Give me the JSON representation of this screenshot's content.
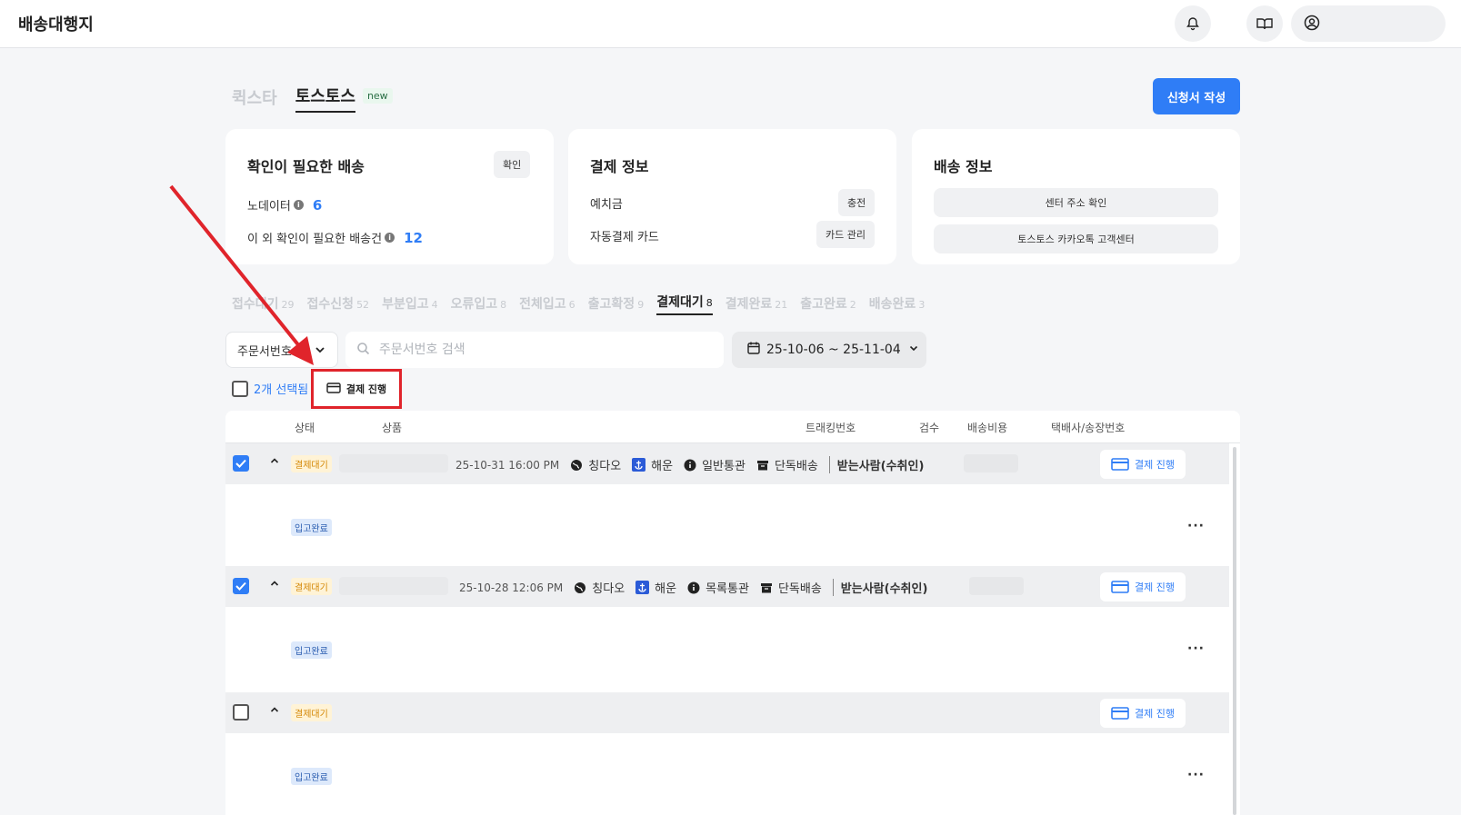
{
  "app": {
    "title": "배송대행지"
  },
  "header": {
    "icons": [
      "bell-icon",
      "book-icon",
      "user-circle-icon"
    ]
  },
  "main_tabs": [
    {
      "label": "퀵스타",
      "active": false
    },
    {
      "label": "토스토스",
      "active": true,
      "badge": "new"
    }
  ],
  "apply_button": "신청서 작성",
  "cards": {
    "check": {
      "title": "확인이 필요한 배송",
      "button": "확인",
      "rows": [
        {
          "label": "노데이터",
          "value": "6"
        },
        {
          "label": "이 외 확인이 필요한 배송건",
          "value": "12"
        }
      ]
    },
    "payment": {
      "title": "결제 정보",
      "rows": [
        {
          "label": "예치금",
          "button": "충전"
        },
        {
          "label": "자동결제 카드",
          "button": "카드 관리"
        }
      ]
    },
    "shipping": {
      "title": "배송 정보",
      "buttons": [
        "센터 주소 확인",
        "토스토스 카카오톡 고객센터"
      ]
    }
  },
  "status_tabs": [
    {
      "label": "접수대기",
      "count": "29"
    },
    {
      "label": "접수신청",
      "count": "52"
    },
    {
      "label": "부분입고",
      "count": "4"
    },
    {
      "label": "오류입고",
      "count": "8"
    },
    {
      "label": "전체입고",
      "count": "6"
    },
    {
      "label": "출고확정",
      "count": "9"
    },
    {
      "label": "결제대기",
      "count": "8",
      "active": true
    },
    {
      "label": "결제완료",
      "count": "21"
    },
    {
      "label": "출고완료",
      "count": "2"
    },
    {
      "label": "배송완료",
      "count": "3"
    }
  ],
  "filters": {
    "select_value": "주문서번호",
    "search_placeholder": "주문서번호 검색",
    "date_range": "25-10-06 ~ 25-11-04"
  },
  "selection": {
    "count_label": "2개 선택됨",
    "action": "결제 진행"
  },
  "table": {
    "headers": {
      "status": "상태",
      "product": "상품",
      "tracking": "트래킹번호",
      "inspection": "검수",
      "shipping_cost": "배송비용",
      "carrier": "택배사/송장번호"
    },
    "rows": [
      {
        "checked": true,
        "status": "결제대기",
        "datetime": "25-10-31 16:00 PM",
        "origin": "칭다오",
        "transport": "해운",
        "customs": "일반통관",
        "delivery": "단독배송",
        "receiver": "받는사람(수취인)",
        "pay_button": "결제 진행",
        "sub_status": "입고완료"
      },
      {
        "checked": true,
        "status": "결제대기",
        "datetime": "25-10-28 12:06 PM",
        "origin": "칭다오",
        "transport": "해운",
        "customs": "목록통관",
        "delivery": "단독배송",
        "receiver": "받는사람(수취인)",
        "pay_button": "결제 진행",
        "sub_status": "입고완료"
      },
      {
        "checked": false,
        "status": "결제대기",
        "pay_button": "결제 진행",
        "sub_status": "입고완료"
      }
    ]
  },
  "colors": {
    "accent": "#2f7df6",
    "highlight": "#e0242b"
  }
}
